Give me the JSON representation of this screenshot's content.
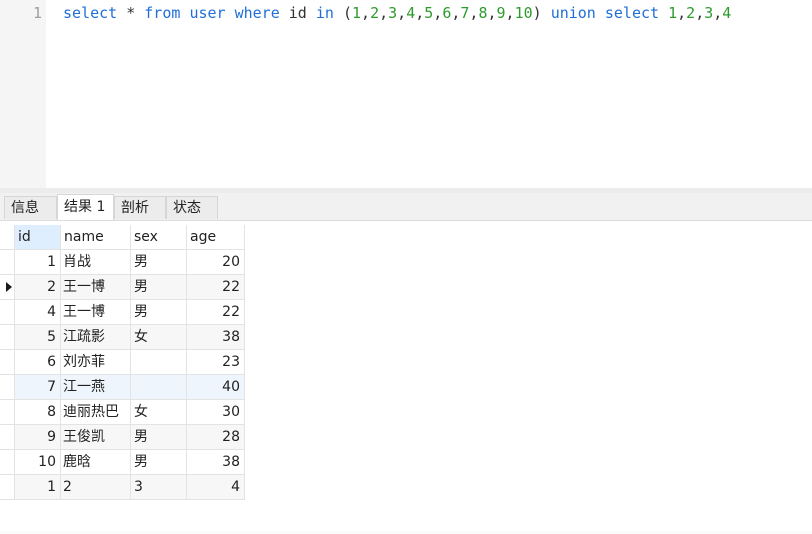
{
  "editor": {
    "line_number": "1",
    "tokens": [
      {
        "t": "select",
        "k": "kw"
      },
      {
        "t": " ",
        "k": "id"
      },
      {
        "t": "*",
        "k": "op"
      },
      {
        "t": " ",
        "k": "id"
      },
      {
        "t": "from",
        "k": "kw"
      },
      {
        "t": " ",
        "k": "id"
      },
      {
        "t": "user",
        "k": "kw"
      },
      {
        "t": " ",
        "k": "id"
      },
      {
        "t": "where",
        "k": "kw"
      },
      {
        "t": " ",
        "k": "id"
      },
      {
        "t": "id",
        "k": "id"
      },
      {
        "t": " ",
        "k": "id"
      },
      {
        "t": "in",
        "k": "kw"
      },
      {
        "t": " (",
        "k": "punct"
      },
      {
        "t": "1",
        "k": "num"
      },
      {
        "t": ",",
        "k": "punct"
      },
      {
        "t": "2",
        "k": "num"
      },
      {
        "t": ",",
        "k": "punct"
      },
      {
        "t": "3",
        "k": "num"
      },
      {
        "t": ",",
        "k": "punct"
      },
      {
        "t": "4",
        "k": "num"
      },
      {
        "t": ",",
        "k": "punct"
      },
      {
        "t": "5",
        "k": "num"
      },
      {
        "t": ",",
        "k": "punct"
      },
      {
        "t": "6",
        "k": "num"
      },
      {
        "t": ",",
        "k": "punct"
      },
      {
        "t": "7",
        "k": "num"
      },
      {
        "t": ",",
        "k": "punct"
      },
      {
        "t": "8",
        "k": "num"
      },
      {
        "t": ",",
        "k": "punct"
      },
      {
        "t": "9",
        "k": "num"
      },
      {
        "t": ",",
        "k": "punct"
      },
      {
        "t": "10",
        "k": "num"
      },
      {
        "t": ") ",
        "k": "punct"
      },
      {
        "t": "union",
        "k": "kw"
      },
      {
        "t": " ",
        "k": "id"
      },
      {
        "t": "select",
        "k": "kw"
      },
      {
        "t": " ",
        "k": "id"
      },
      {
        "t": "1",
        "k": "num"
      },
      {
        "t": ",",
        "k": "punct"
      },
      {
        "t": "2",
        "k": "num"
      },
      {
        "t": ",",
        "k": "punct"
      },
      {
        "t": "3",
        "k": "num"
      },
      {
        "t": ",",
        "k": "punct"
      },
      {
        "t": "4",
        "k": "num"
      }
    ]
  },
  "tabs": [
    "信息",
    "结果 1",
    "剖析",
    "状态"
  ],
  "active_tab_index": 1,
  "grid": {
    "columns": [
      "id",
      "name",
      "sex",
      "age"
    ],
    "selected_row_index": 1,
    "highlighted_row_index": 5,
    "rows": [
      [
        "1",
        "肖战",
        "男",
        "20"
      ],
      [
        "2",
        "王一博",
        "男",
        "22"
      ],
      [
        "4",
        "王一博",
        "男",
        "22"
      ],
      [
        "5",
        "江疏影",
        "女",
        "38"
      ],
      [
        "6",
        "刘亦菲",
        "",
        "23"
      ],
      [
        "7",
        "江一燕",
        "",
        "40"
      ],
      [
        "8",
        "迪丽热巴",
        "女",
        "30"
      ],
      [
        "9",
        "王俊凯",
        "男",
        "28"
      ],
      [
        "10",
        "鹿晗",
        "男",
        "38"
      ],
      [
        "1",
        "2",
        "3",
        "4"
      ]
    ]
  },
  "colors": {
    "keyword": "#1f6fd8",
    "number": "#2e9b2e",
    "header_selected": "#dfeefe"
  }
}
